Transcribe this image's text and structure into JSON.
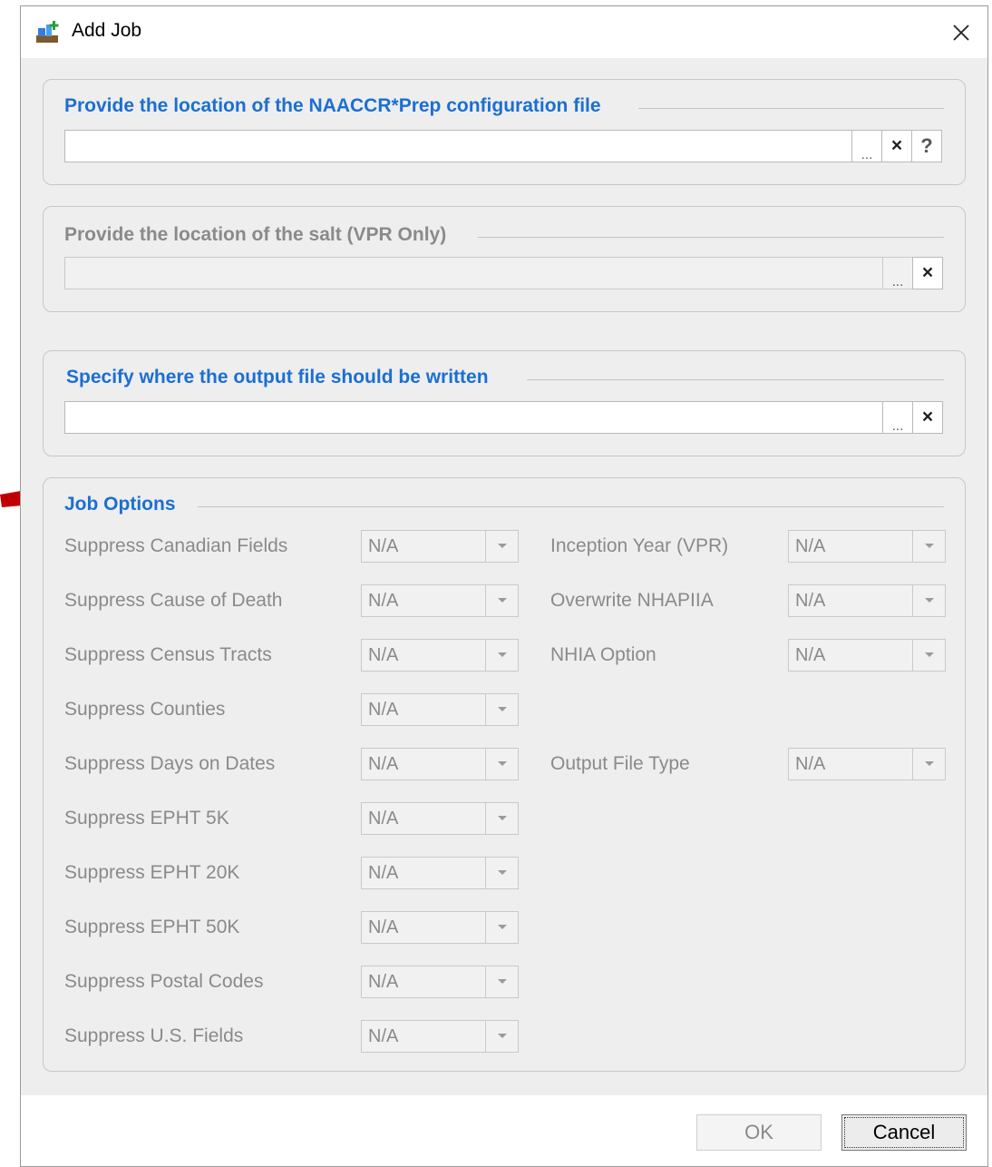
{
  "window": {
    "title": "Add Job"
  },
  "config_panel": {
    "title": "Provide the location of the NAACCR*Prep configuration file",
    "path_value": ""
  },
  "salt_panel": {
    "title": "Provide the location of the salt (VPR Only)",
    "path_value": ""
  },
  "output_panel": {
    "title": "Specify where the output file should be written",
    "path_value": ""
  },
  "buttons": {
    "browse": "...",
    "clear": "×",
    "help": "?"
  },
  "job_options": {
    "title": "Job Options",
    "left": [
      {
        "label": "Suppress Canadian Fields",
        "value": "N/A"
      },
      {
        "label": "Suppress Cause of Death",
        "value": "N/A"
      },
      {
        "label": "Suppress Census Tracts",
        "value": "N/A"
      },
      {
        "label": "Suppress Counties",
        "value": "N/A"
      },
      {
        "label": "Suppress Days on Dates",
        "value": "N/A"
      },
      {
        "label": "Suppress EPHT 5K",
        "value": "N/A"
      },
      {
        "label": "Suppress EPHT 20K",
        "value": "N/A"
      },
      {
        "label": "Suppress EPHT 50K",
        "value": "N/A"
      },
      {
        "label": "Suppress Postal Codes",
        "value": "N/A"
      },
      {
        "label": "Suppress U.S. Fields",
        "value": "N/A"
      }
    ],
    "right": [
      {
        "label": "Inception Year (VPR)",
        "value": "N/A"
      },
      {
        "label": "Overwrite NHAPIIA",
        "value": "N/A"
      },
      {
        "label": "NHIA Option",
        "value": "N/A"
      },
      {
        "label": "Output File Type",
        "value": "N/A"
      }
    ]
  },
  "footer": {
    "ok_label": "OK",
    "cancel_label": "Cancel"
  },
  "colors": {
    "accent": "#1b6fd1",
    "arrow": "#c00000",
    "disabled_text": "#8a8a8a"
  }
}
